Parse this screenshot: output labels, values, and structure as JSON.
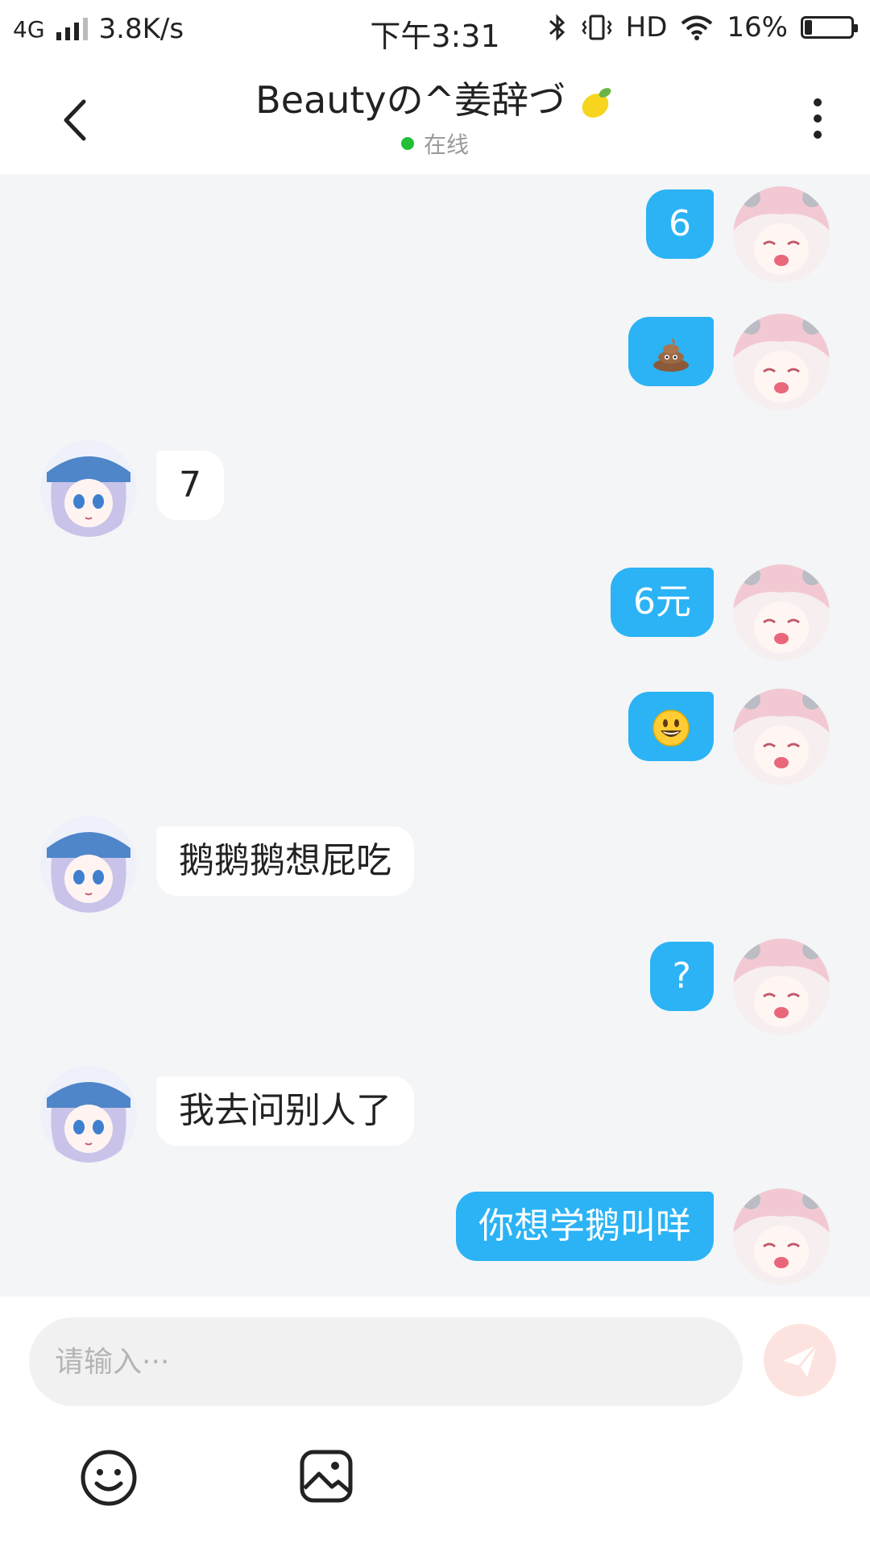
{
  "status_bar": {
    "network": "4G",
    "speed": "3.8K/s",
    "time": "下午3:31",
    "hd": "HD",
    "battery": "16%",
    "battery_level": 0.16
  },
  "header": {
    "title": "Beautyの^姜辞づ",
    "status": "在线"
  },
  "messages": [
    {
      "side": "me",
      "text": "6"
    },
    {
      "side": "me",
      "emoji": "poo-emoji"
    },
    {
      "side": "them",
      "text": "7"
    },
    {
      "side": "me",
      "text": "6元"
    },
    {
      "side": "me",
      "emoji": "smiley-emoji"
    },
    {
      "side": "them",
      "text": "鹅鹅鹅想屁吃"
    },
    {
      "side": "me",
      "text": "?"
    },
    {
      "side": "them",
      "text": "我去问别人了"
    },
    {
      "side": "me",
      "text": "你想学鹅叫咩"
    }
  ],
  "input": {
    "placeholder": "请输入···"
  },
  "colors": {
    "my_bubble": "#2bb3f5",
    "their_bubble": "#ffffff",
    "chat_background": "#f3f5f7",
    "online_dot": "#21c036",
    "send_button": "#fde3df"
  },
  "icons": [
    "back-arrow-icon",
    "more-vertical-icon",
    "send-icon",
    "emoji-icon",
    "image-icon",
    "lemon-emoji"
  ]
}
